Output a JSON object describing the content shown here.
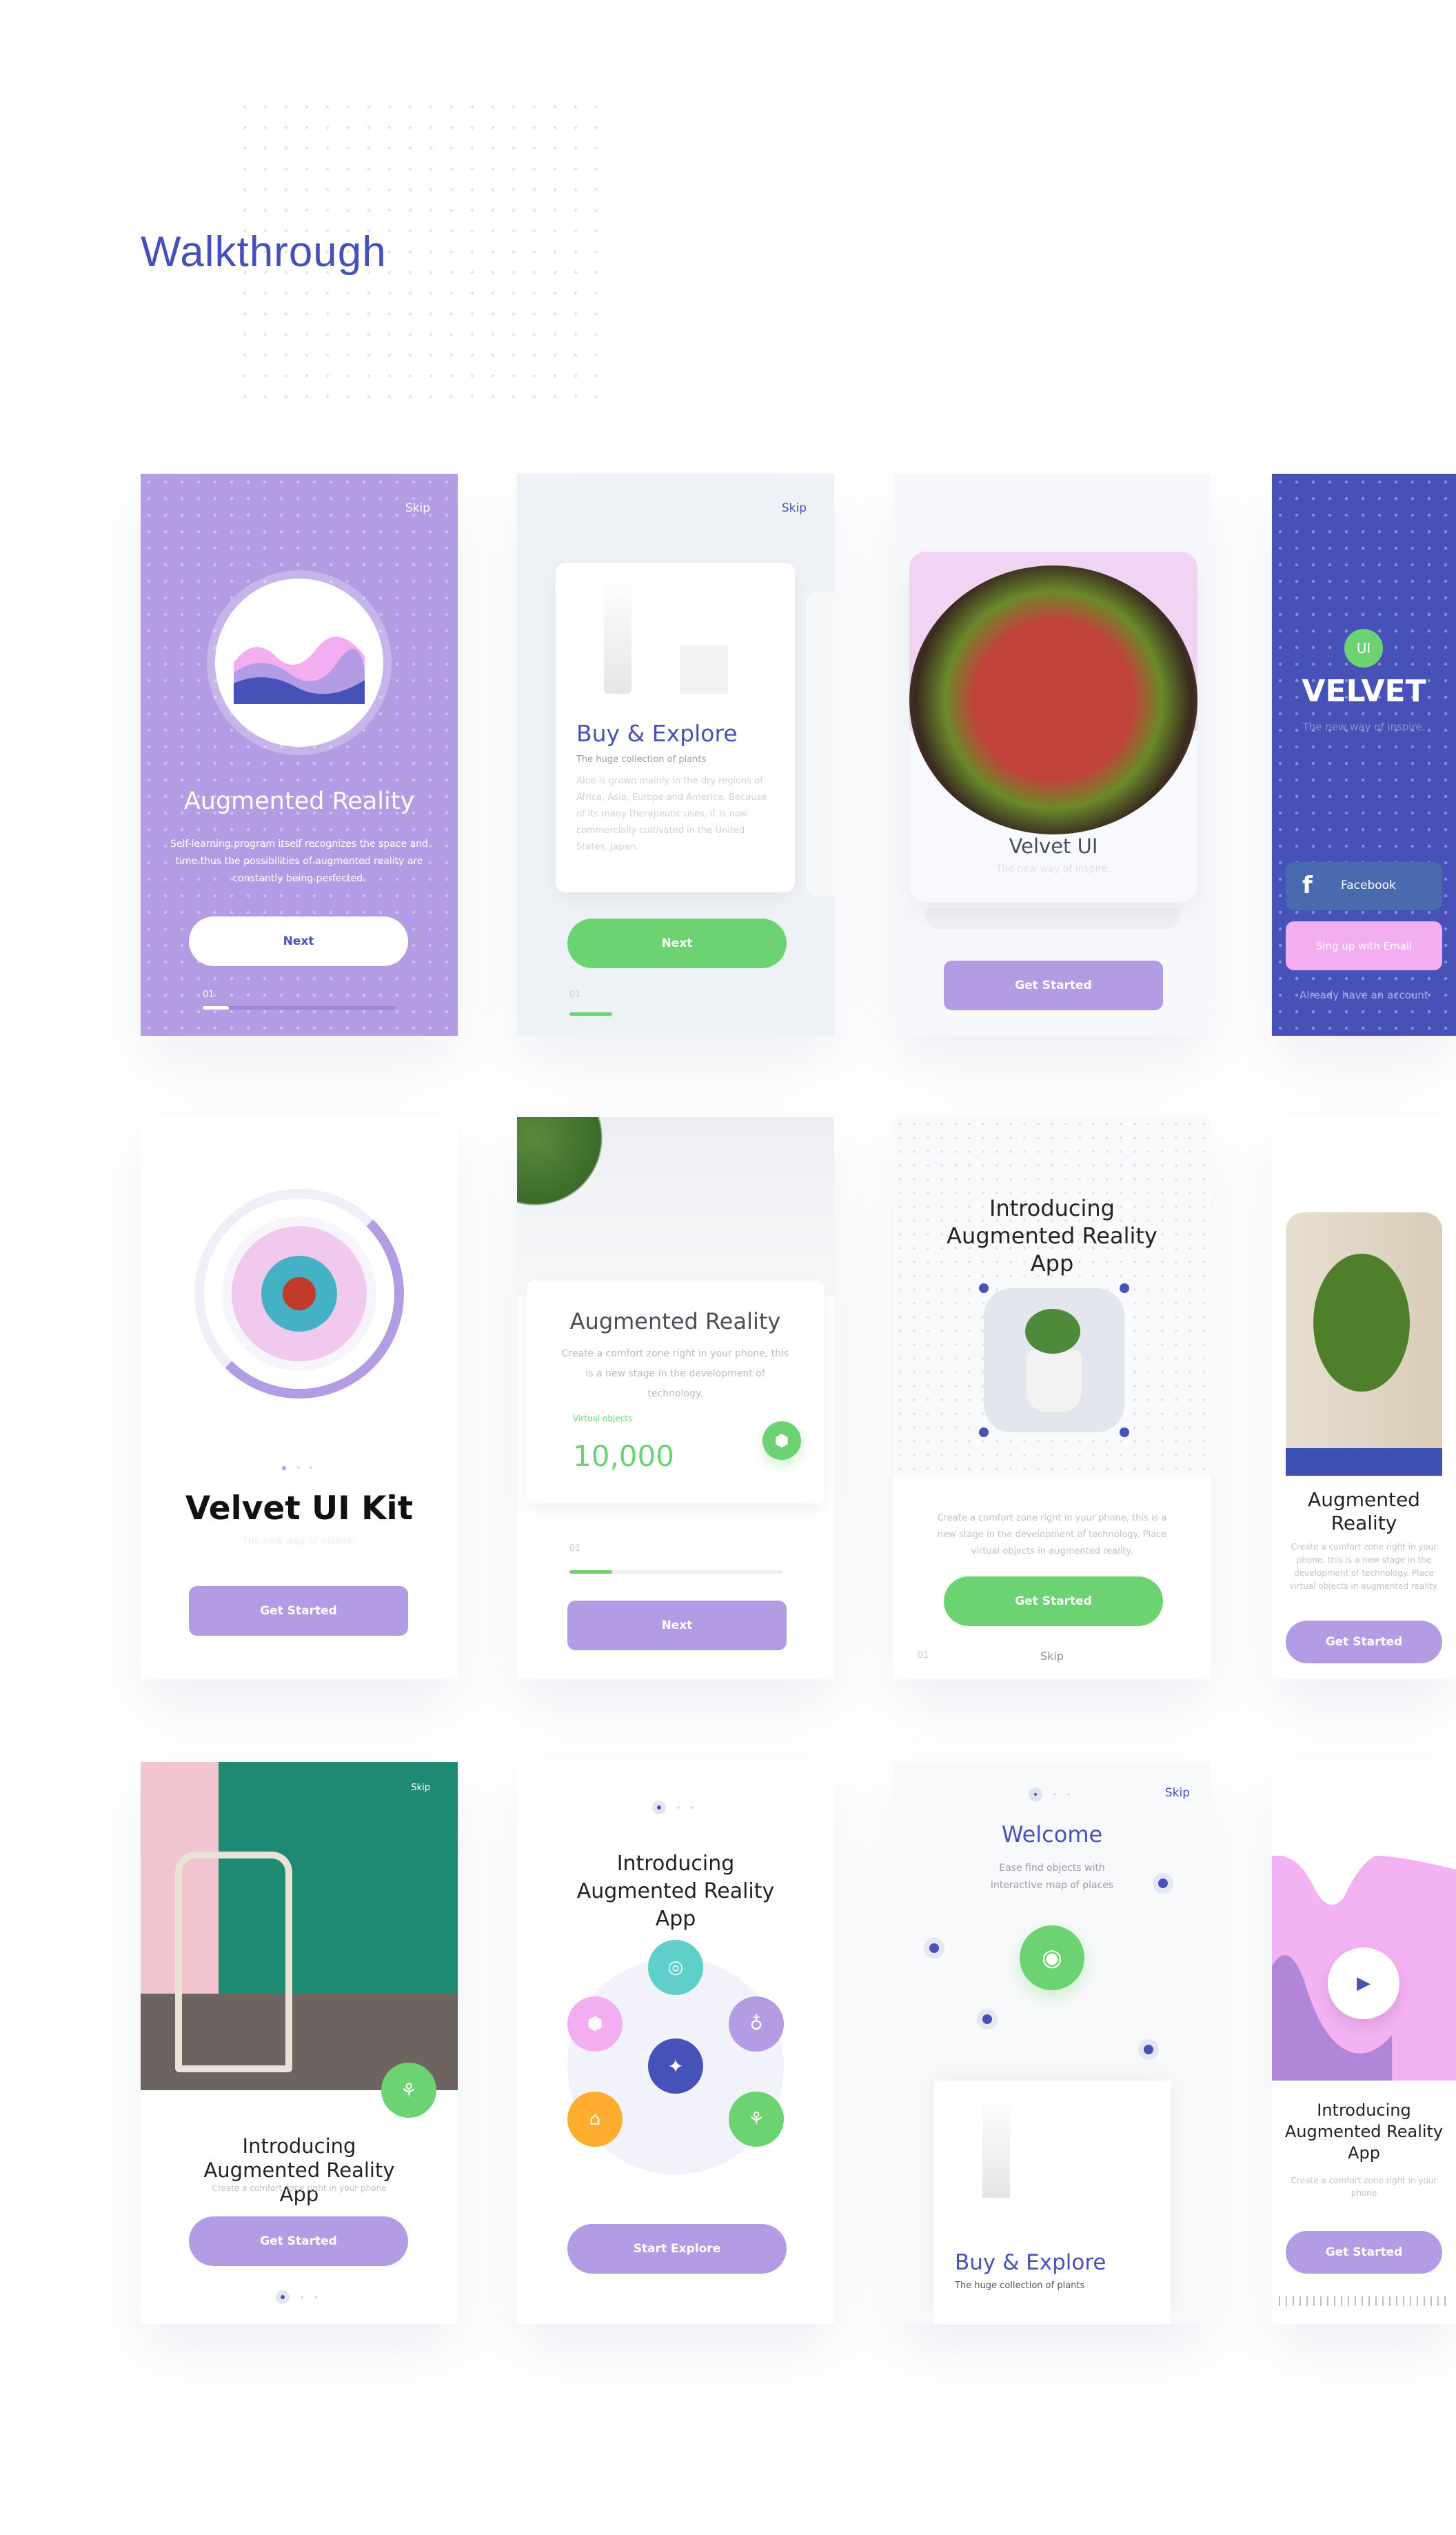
{
  "page": {
    "title": "Walkthrough"
  },
  "colors": {
    "accent": "#4752b8",
    "purple": "#b39ce4",
    "green": "#6dd372",
    "pink": "#f3aef2"
  },
  "row1": {
    "card1": {
      "skip": "Skip",
      "title": "Augmented Reality",
      "desc": "Self-learning program itself recognizes the space and time thus the possibilities of augmented reality are constantly being perfected.",
      "button": "Next",
      "step": "01",
      "progress": 0.2
    },
    "card2": {
      "skip": "Skip",
      "title": "Buy & Explore",
      "subtitle": "The huge collection of plants",
      "desc": "Aloe is grown mainly in the dry regions of Africa, Asia, Europe and America. Because of its many therapeutic uses, it is now commercially cultivated in the United States, Japan.",
      "button": "Next",
      "step": "01",
      "progress": 0.2
    },
    "card3": {
      "title": "Velvet UI",
      "subtitle": "The new way of inspire.",
      "button": "Get Started"
    },
    "card4": {
      "badge": "UI",
      "title": "VELVET",
      "subtitle": "The new way of inspire.",
      "facebook": "Facebook",
      "signup": "Sing up with Email",
      "login": "Already have an account"
    }
  },
  "row2": {
    "card1": {
      "title": "Velvet UI Kit",
      "subtitle": "The new way of inspire.",
      "button": "Get Started"
    },
    "card2": {
      "title": "Augmented Reality",
      "desc": "Create a comfort zone right in your phone, this is a new stage in the development of technology.",
      "stat_label": "Virtual objects",
      "stat_value": "10,000",
      "step": "01",
      "progress": 0.2,
      "button": "Next"
    },
    "card3": {
      "title": "Introducing Augmented Reality App",
      "desc": "Create a comfort zone right in your phone, this is a new stage in the development of technology. Place virtual objects in augmented reality.",
      "button": "Get Started",
      "step": "01",
      "skip": "Skip"
    },
    "card4": {
      "title": "Augmented Reality",
      "desc": "Create a comfort zone right in your phone, this is a new stage in the development of technology. Place virtual objects in augmented reality.",
      "button": "Get Started"
    }
  },
  "row3": {
    "card1": {
      "skip": "Skip",
      "title": "Introducing Augmented Reality App",
      "desc": "Create a comfort zone right in your phone",
      "button": "Get Started"
    },
    "card2": {
      "title": "Introducing Augmented Reality App",
      "button": "Start Explore"
    },
    "card3": {
      "skip": "Skip",
      "title": "Welcome",
      "desc": "Ease find objects with Interactive map of places",
      "card_title": "Buy & Explore",
      "card_subtitle": "The huge collection of plants"
    },
    "card4": {
      "title": "Introducing Augmented Reality App",
      "desc": "Create a comfort zone right in your phone",
      "button": "Get Started"
    }
  }
}
